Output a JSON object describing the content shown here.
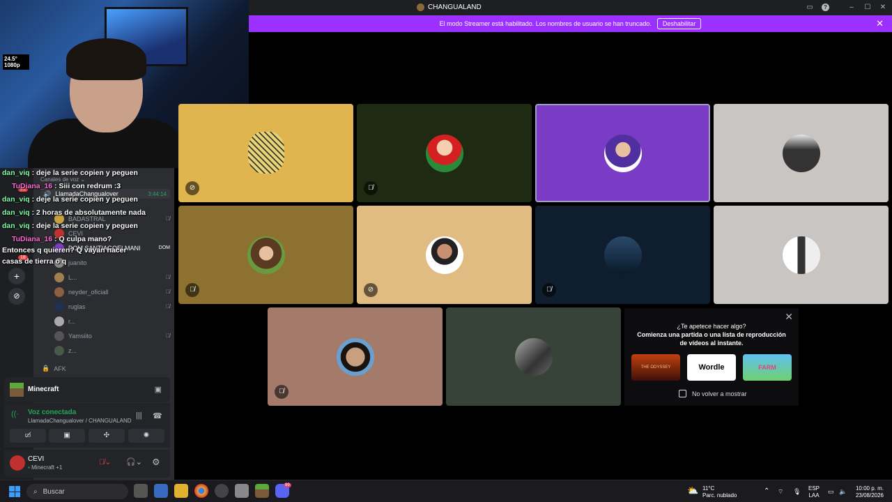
{
  "window": {
    "title": "CHANGUALAND"
  },
  "banner": {
    "text": "El modo Streamer está habilitado. Los nombres de usuario se han truncado.",
    "button": "Deshabilitar"
  },
  "webcam": {
    "overlay_temp": "24.5°",
    "overlay_res": "1080p"
  },
  "chat": [
    {
      "name": "dan_viq",
      "text": " : deje la serie copien y peguen",
      "color": "green"
    },
    {
      "name": "TuDiana_16",
      "text": " : Siii con redrum :3",
      "color": "pink"
    },
    {
      "name": "dan_viq",
      "text": " : deje la serie copien y peguen",
      "color": "green"
    },
    {
      "name": "dan_viq",
      "text": " : 2 horas de absolutamente nada",
      "color": "green"
    },
    {
      "name": "dan_viq",
      "text": " : deje la serie copien y peguen",
      "color": "green"
    },
    {
      "name": "TuDiana_16",
      "text": " : Q culpa mano?",
      "color": "pink"
    },
    {
      "name": "",
      "text": "Entonces q quieren? Q vayan hacer",
      "color": "white"
    },
    {
      "name": "",
      "text": "casas de tierra o q",
      "color": "white"
    }
  ],
  "sidebar": {
    "section_label": "Canales de voz",
    "voice_channel": "LlamadaChangualover",
    "call_timer": "3:44:14",
    "badges": [
      "91",
      "18"
    ],
    "members": [
      {
        "name": "BADASTRAL"
      },
      {
        "name": "CEVI"
      },
      {
        "name": "DOM SANTIAGOELMANI",
        "tag": "DOM"
      },
      {
        "name": "juanito"
      },
      {
        "name": "L..."
      },
      {
        "name": "neyder_oficiall"
      },
      {
        "name": "ruglas"
      },
      {
        "name": "r..."
      },
      {
        "name": "Yamsiito"
      },
      {
        "name": "z..."
      }
    ],
    "afk_channel": "AFK"
  },
  "activity_card": {
    "game": "Minecraft"
  },
  "voice_status": {
    "status": "Voz conectada",
    "location": "LlamadaChangualover / CHANGUALAND"
  },
  "user": {
    "name": "CEVI",
    "activity": "Minecraft",
    "extra": "+1"
  },
  "activity_panel": {
    "title": "¿Te apetece hacer algo?",
    "subtitle_1": "Comienza una partida o una lista de reproducción",
    "subtitle_2": "de vídeos al instante.",
    "games": [
      "THE ODYSSEY",
      "Wordle",
      "FARM"
    ],
    "dont_show": "No volver a mostrar"
  },
  "taskbar": {
    "search_placeholder": "Buscar",
    "discord_badge": "99",
    "weather_temp": "11°C",
    "weather_desc": "Parc. nublado",
    "lang_1": "ESP",
    "lang_2": "LAA",
    "time": "10:00 p. m.",
    "date": "23/08/2026"
  },
  "colors": {
    "banner": "#9b30ff",
    "speaking_tile": "#7a3cc4",
    "green": "#23a55a"
  }
}
